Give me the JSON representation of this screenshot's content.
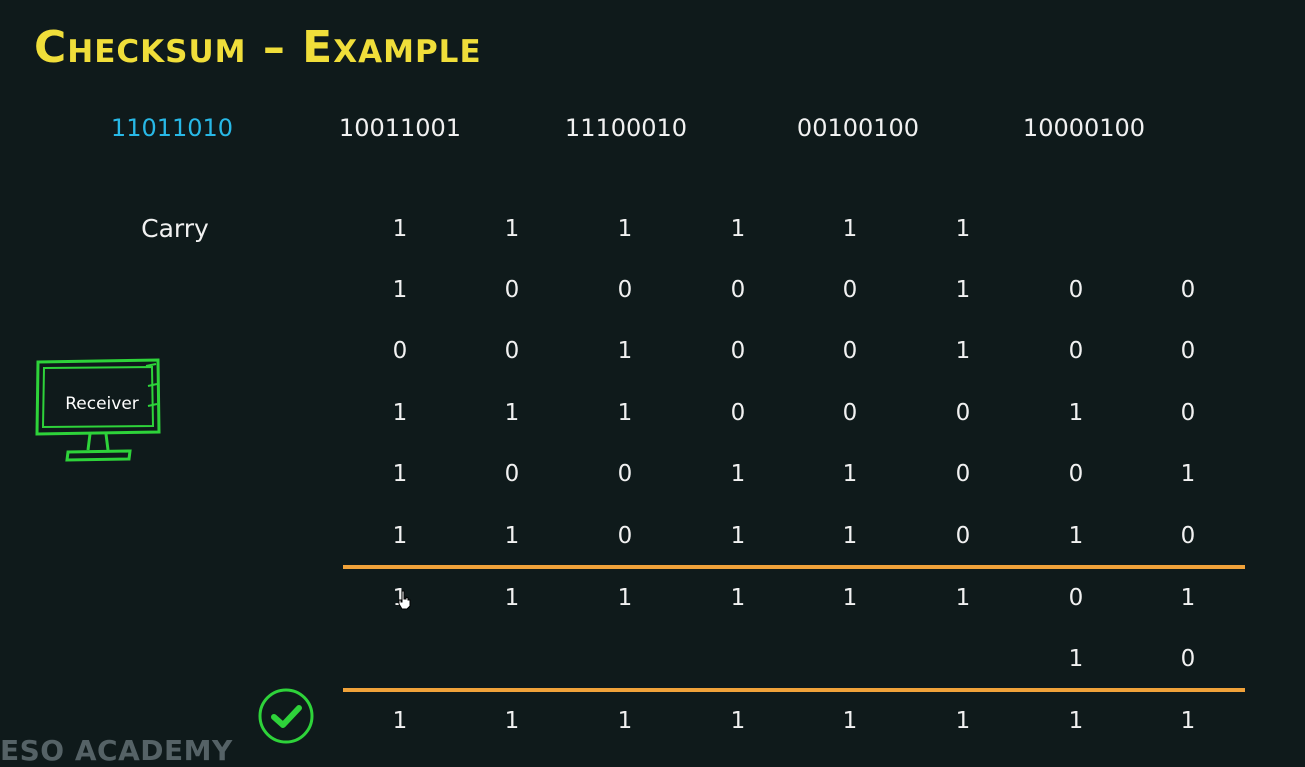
{
  "title": "Checksum – Example",
  "top_words": [
    {
      "text": "11011010",
      "highlight": true
    },
    {
      "text": "10011001",
      "highlight": false
    },
    {
      "text": "11100010",
      "highlight": false
    },
    {
      "text": "00100100",
      "highlight": false
    },
    {
      "text": "10000100",
      "highlight": false
    }
  ],
  "carry_label": "Carry",
  "carry_row": [
    "1",
    "1",
    "1",
    "1",
    "1",
    "1",
    "",
    ""
  ],
  "operand_rows": [
    [
      "1",
      "0",
      "0",
      "0",
      "0",
      "1",
      "0",
      "0"
    ],
    [
      "0",
      "0",
      "1",
      "0",
      "0",
      "1",
      "0",
      "0"
    ],
    [
      "1",
      "1",
      "1",
      "0",
      "0",
      "0",
      "1",
      "0"
    ],
    [
      "1",
      "0",
      "0",
      "1",
      "1",
      "0",
      "0",
      "1"
    ],
    [
      "1",
      "1",
      "0",
      "1",
      "1",
      "0",
      "1",
      "0"
    ]
  ],
  "sum_row": [
    "1",
    "1",
    "1",
    "1",
    "1",
    "1",
    "0",
    "1"
  ],
  "wrap_row": [
    "",
    "",
    "",
    "",
    "",
    "",
    "1",
    "0"
  ],
  "result_row": [
    "1",
    "1",
    "1",
    "1",
    "1",
    "1",
    "1",
    "1"
  ],
  "receiver_label": "Receiver",
  "watermark": "ESO ACADEMY",
  "colors": {
    "background": "#0f1a1b",
    "title": "#f0de3a",
    "highlight": "#28b8e6",
    "rule": "#f0a23a",
    "monitor": "#2ed33a",
    "check": "#2ed33a"
  }
}
